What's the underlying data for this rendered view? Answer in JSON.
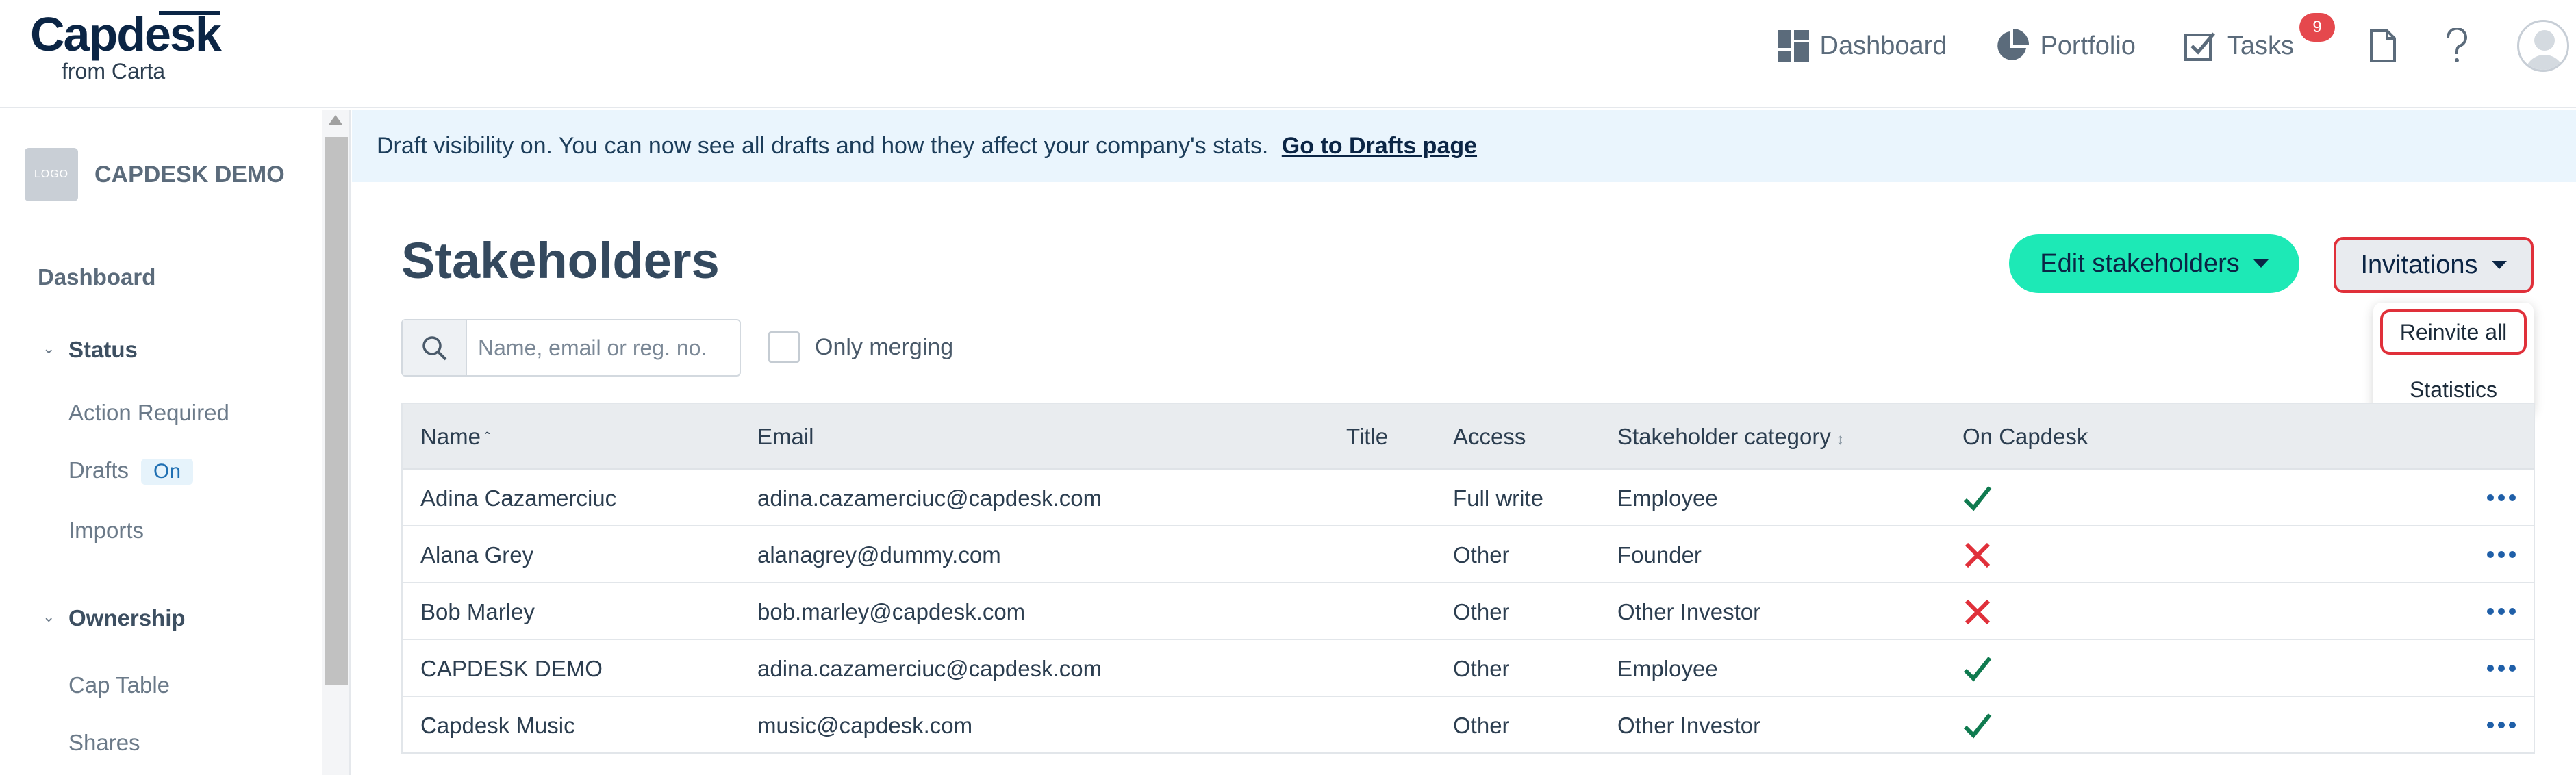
{
  "brand": {
    "name": "Capdesk",
    "sub": "from Carta"
  },
  "nav": {
    "dashboard": "Dashboard",
    "portfolio": "Portfolio",
    "tasks": "Tasks",
    "tasks_badge": "9"
  },
  "sidebar": {
    "company_logo": "LOGO",
    "company_name": "CAPDESK DEMO",
    "dashboard": "Dashboard",
    "status_head": "Status",
    "action_required": "Action Required",
    "drafts": "Drafts",
    "drafts_pill": "On",
    "imports": "Imports",
    "ownership_head": "Ownership",
    "cap_table": "Cap Table",
    "shares": "Shares"
  },
  "banner": {
    "text": "Draft visibility on. You can now see all drafts and how they affect your company's stats.",
    "link": "Go to Drafts page"
  },
  "page": {
    "title": "Stakeholders",
    "edit_button": "Edit stakeholders",
    "invitations_button": "Invitations",
    "dropdown": {
      "reinvite": "Reinvite all",
      "statistics": "Statistics"
    },
    "search_placeholder": "Name, email or reg. no.",
    "only_merging": "Only merging"
  },
  "table": {
    "headers": {
      "name": "Name",
      "email": "Email",
      "title": "Title",
      "access": "Access",
      "category": "Stakeholder category",
      "on_capdesk": "On Capdesk"
    },
    "rows": [
      {
        "name": "Adina Cazamerciuc",
        "email": "adina.cazamerciuc@capdesk.com",
        "access": "Full write",
        "category": "Employee",
        "on_capdesk": true
      },
      {
        "name": "Alana Grey",
        "email": "alanagrey@dummy.com",
        "access": "Other",
        "category": "Founder",
        "on_capdesk": false
      },
      {
        "name": "Bob Marley",
        "email": "bob.marley@capdesk.com",
        "access": "Other",
        "category": "Other Investor",
        "on_capdesk": false
      },
      {
        "name": "CAPDESK DEMO",
        "email": "adina.cazamerciuc@capdesk.com",
        "access": "Other",
        "category": "Employee",
        "on_capdesk": true
      },
      {
        "name": "Capdesk Music",
        "email": "music@capdesk.com",
        "access": "Other",
        "category": "Other Investor",
        "on_capdesk": true
      }
    ]
  },
  "colors": {
    "accent": "#1de9b6",
    "danger": "#e0303a",
    "success": "#0f7a4f",
    "navy": "#0b2545"
  }
}
